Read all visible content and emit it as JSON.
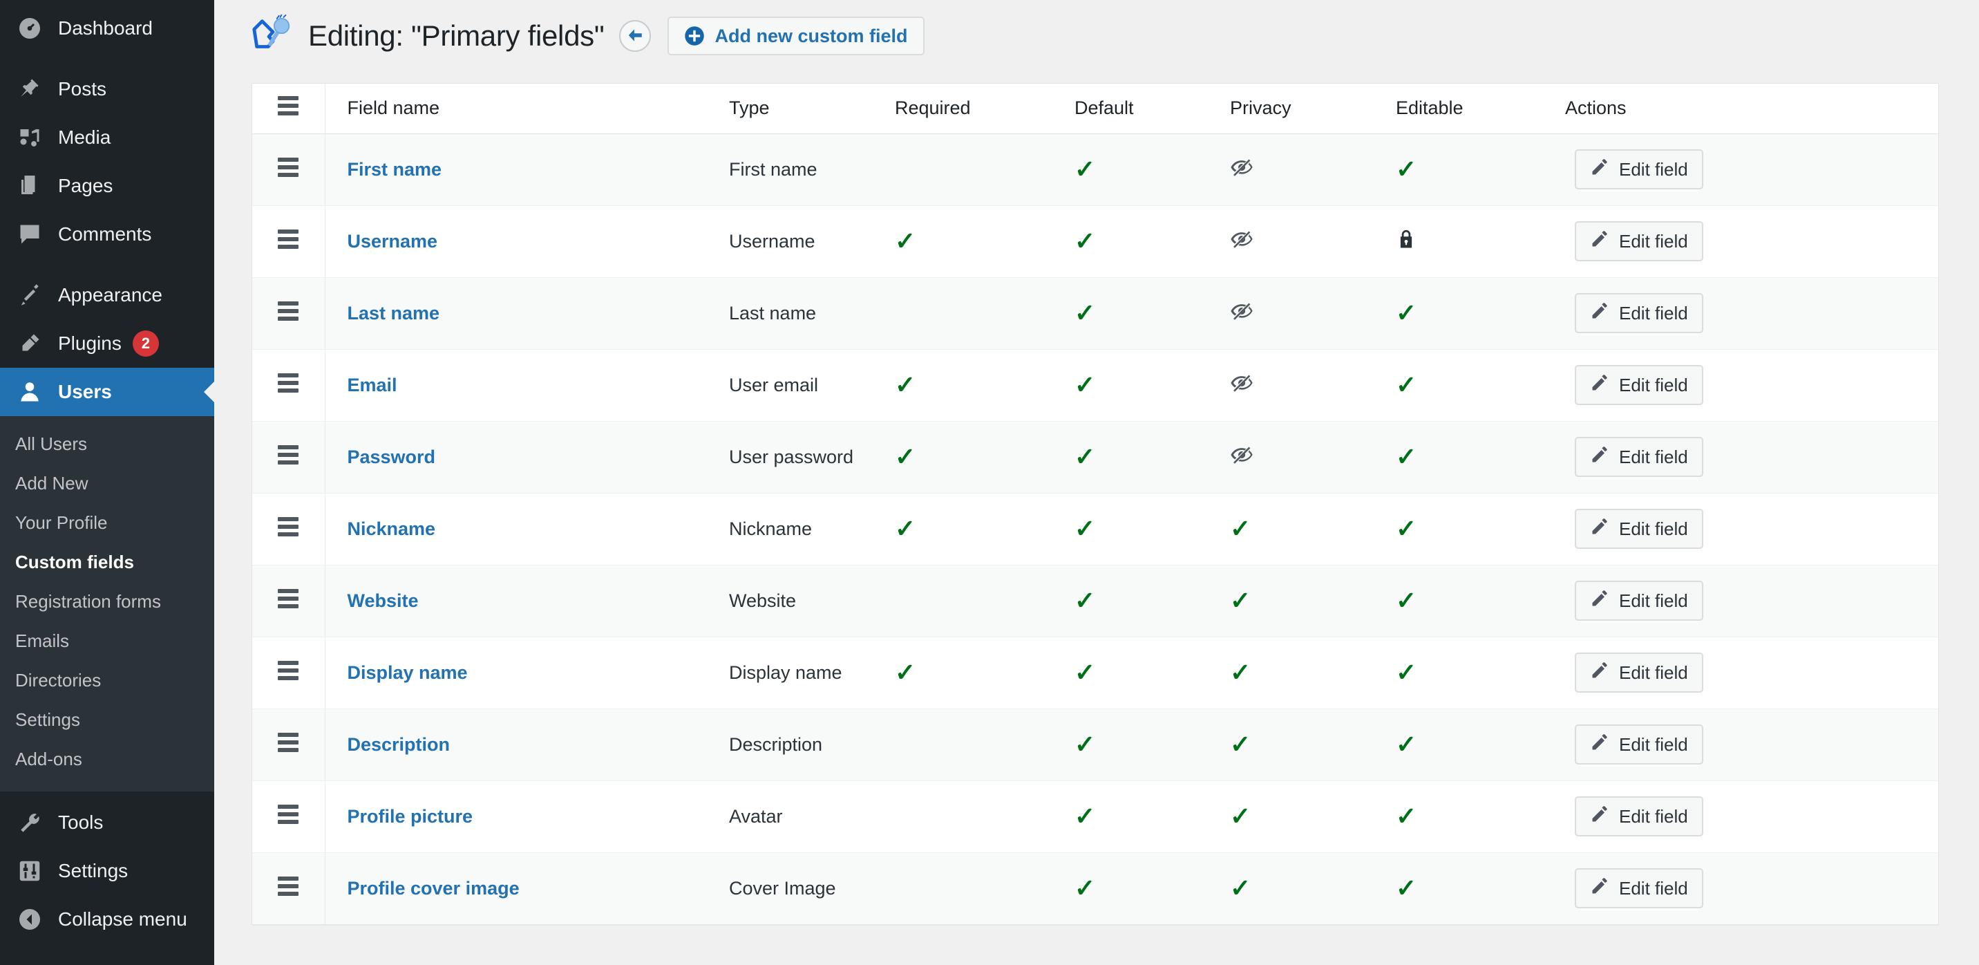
{
  "sidebar": {
    "items": [
      {
        "label": "Dashboard",
        "icon": "dashboard-icon"
      },
      {
        "label": "Posts",
        "icon": "pin-icon"
      },
      {
        "label": "Media",
        "icon": "media-icon"
      },
      {
        "label": "Pages",
        "icon": "pages-icon"
      },
      {
        "label": "Comments",
        "icon": "comments-icon"
      },
      {
        "label": "Appearance",
        "icon": "appearance-icon"
      },
      {
        "label": "Plugins",
        "icon": "plugins-icon",
        "badge": "2"
      },
      {
        "label": "Users",
        "icon": "users-icon",
        "current": true
      },
      {
        "label": "Tools",
        "icon": "tools-icon"
      },
      {
        "label": "Settings",
        "icon": "settings-icon"
      },
      {
        "label": "Collapse menu",
        "icon": "collapse-icon"
      }
    ],
    "users_submenu": [
      {
        "label": "All Users"
      },
      {
        "label": "Add New"
      },
      {
        "label": "Your Profile"
      },
      {
        "label": "Custom fields",
        "active": true
      },
      {
        "label": "Registration forms"
      },
      {
        "label": "Emails"
      },
      {
        "label": "Directories"
      },
      {
        "label": "Settings"
      },
      {
        "label": "Add-ons"
      }
    ]
  },
  "header": {
    "logo_icon": "profile-builder-logo-icon",
    "title": "Editing: \"Primary fields\"",
    "back_icon": "arrow-left-icon",
    "add_button": {
      "label": "Add new custom field",
      "icon": "plus-circle-icon"
    }
  },
  "table": {
    "columns": [
      "",
      "Field name",
      "Type",
      "Required",
      "Default",
      "Privacy",
      "Editable",
      "Actions"
    ],
    "action_label": "Edit field",
    "action_icon": "pencil-icon",
    "handle_icon": "drag-handle-icon",
    "rows": [
      {
        "name": "First name",
        "type": "First name",
        "required": "",
        "default": "check",
        "privacy": "eye-off",
        "editable": "check"
      },
      {
        "name": "Username",
        "type": "Username",
        "required": "check",
        "default": "check",
        "privacy": "eye-off",
        "editable": "lock"
      },
      {
        "name": "Last name",
        "type": "Last name",
        "required": "",
        "default": "check",
        "privacy": "eye-off",
        "editable": "check"
      },
      {
        "name": "Email",
        "type": "User email",
        "required": "check",
        "default": "check",
        "privacy": "eye-off",
        "editable": "check"
      },
      {
        "name": "Password",
        "type": "User password",
        "required": "check",
        "default": "check",
        "privacy": "eye-off",
        "editable": "check"
      },
      {
        "name": "Nickname",
        "type": "Nickname",
        "required": "check",
        "default": "check",
        "privacy": "check",
        "editable": "check"
      },
      {
        "name": "Website",
        "type": "Website",
        "required": "",
        "default": "check",
        "privacy": "check",
        "editable": "check"
      },
      {
        "name": "Display name",
        "type": "Display name",
        "required": "check",
        "default": "check",
        "privacy": "check",
        "editable": "check"
      },
      {
        "name": "Description",
        "type": "Description",
        "required": "",
        "default": "check",
        "privacy": "check",
        "editable": "check"
      },
      {
        "name": "Profile picture",
        "type": "Avatar",
        "required": "",
        "default": "check",
        "privacy": "check",
        "editable": "check"
      },
      {
        "name": "Profile cover image",
        "type": "Cover Image",
        "required": "",
        "default": "check",
        "privacy": "check",
        "editable": "check"
      }
    ]
  },
  "colors": {
    "sidebar_bg": "#1d2327",
    "submenu_bg": "#2c3338",
    "current_blue": "#2271b1",
    "link_blue": "#2271b1",
    "check_green": "#007017",
    "badge_red": "#d63638",
    "page_bg": "#f0f0f1"
  }
}
